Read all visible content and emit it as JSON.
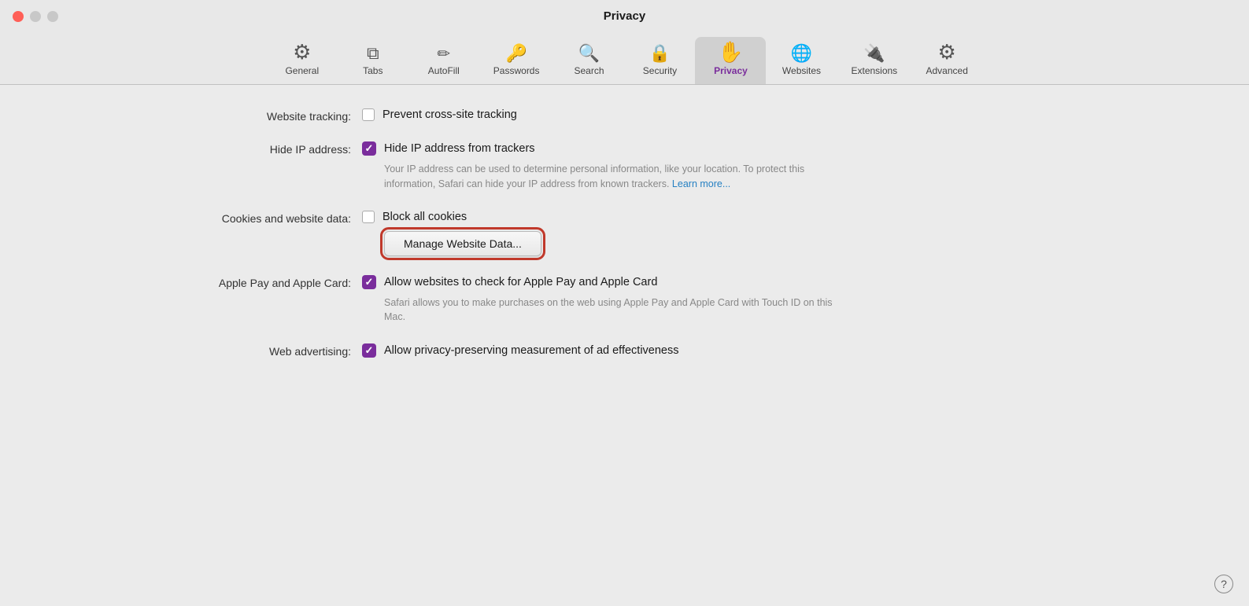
{
  "window": {
    "title": "Privacy",
    "controls": {
      "close": "close",
      "minimize": "minimize",
      "maximize": "maximize"
    }
  },
  "toolbar": {
    "items": [
      {
        "id": "general",
        "label": "General",
        "icon": "⚙",
        "active": false
      },
      {
        "id": "tabs",
        "label": "Tabs",
        "icon": "⧉",
        "active": false
      },
      {
        "id": "autofill",
        "label": "AutoFill",
        "icon": "✏",
        "active": false
      },
      {
        "id": "passwords",
        "label": "Passwords",
        "icon": "🔑",
        "active": false
      },
      {
        "id": "search",
        "label": "Search",
        "icon": "🔍",
        "active": false
      },
      {
        "id": "security",
        "label": "Security",
        "icon": "🔒",
        "active": false
      },
      {
        "id": "privacy",
        "label": "Privacy",
        "icon": "✋",
        "active": true
      },
      {
        "id": "websites",
        "label": "Websites",
        "icon": "🌐",
        "active": false
      },
      {
        "id": "extensions",
        "label": "Extensions",
        "icon": "🔌",
        "active": false
      },
      {
        "id": "advanced",
        "label": "Advanced",
        "icon": "⚙",
        "active": false
      }
    ]
  },
  "settings": {
    "website_tracking": {
      "label": "Website tracking:",
      "checkbox_checked": false,
      "text": "Prevent cross-site tracking"
    },
    "hide_ip": {
      "label": "Hide IP address:",
      "checkbox_checked": true,
      "text": "Hide IP address from trackers",
      "description": "Your IP address can be used to determine personal information, like your location. To protect this information, Safari can hide your IP address from known trackers.",
      "link_text": "Learn more..."
    },
    "cookies": {
      "label": "Cookies and website data:",
      "checkbox_checked": false,
      "text": "Block all cookies",
      "manage_btn_label": "Manage Website Data..."
    },
    "apple_pay": {
      "label": "Apple Pay and Apple Card:",
      "checkbox_checked": true,
      "text": "Allow websites to check for Apple Pay and Apple Card",
      "description": "Safari allows you to make purchases on the web using Apple Pay and Apple Card with Touch ID on this Mac."
    },
    "web_advertising": {
      "label": "Web advertising:",
      "checkbox_checked": true,
      "text": "Allow privacy-preserving measurement of ad effectiveness"
    }
  },
  "help": {
    "label": "?"
  }
}
